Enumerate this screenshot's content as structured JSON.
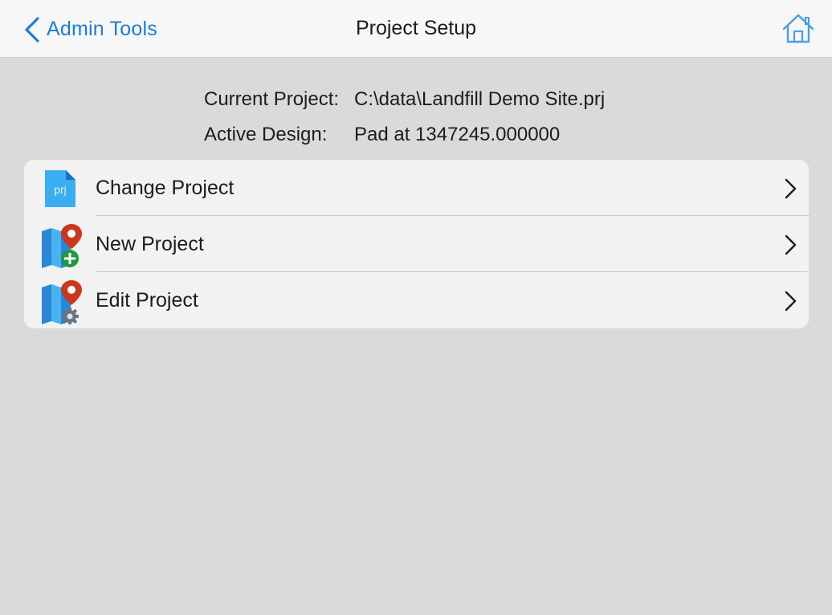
{
  "nav": {
    "back_label": "Admin Tools",
    "title": "Project Setup",
    "back_icon": "chevron-left-icon",
    "home_icon": "home-icon",
    "accent_color": "#1a7de0"
  },
  "info": {
    "project_label": "Current Project:",
    "project_value": "C:\\data\\Landfill Demo Site.prj",
    "design_label": "Active Design:",
    "design_value": "Pad at 1347245.000000"
  },
  "menu": {
    "items": [
      {
        "label": "Change Project",
        "icon": "prj-file-icon",
        "icon_text": "prj"
      },
      {
        "label": "New Project",
        "icon": "map-pin-add-icon"
      },
      {
        "label": "Edit Project",
        "icon": "map-pin-settings-icon"
      }
    ],
    "chevron_icon": "chevron-right-icon"
  }
}
